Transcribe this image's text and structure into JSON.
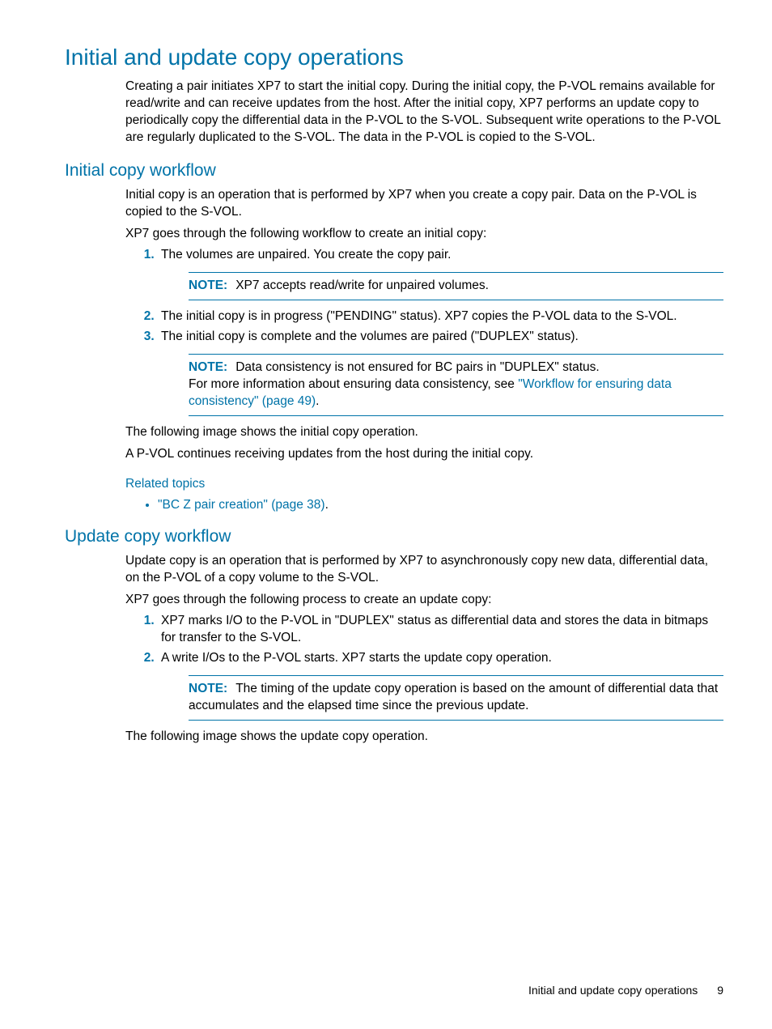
{
  "h1": "Initial and update copy operations",
  "p_intro": "Creating a pair initiates XP7 to start the initial copy. During the initial copy, the P-VOL remains available for read/write and can receive updates from the host. After the initial copy, XP7 performs an update copy to periodically copy the differential data in the P-VOL to the S-VOL. Subsequent write operations to the P-VOL are regularly duplicated to the S-VOL. The data in the P-VOL is copied to the S-VOL.",
  "h2_initial": "Initial copy workflow",
  "p_initial1": "Initial copy is an operation that is performed by XP7 when you create a copy pair. Data on the P-VOL is copied to the S-VOL.",
  "p_initial2": "XP7 goes through the following workflow to create an initial copy:",
  "ol1_li1": "The volumes are unpaired. You create the copy pair.",
  "note_label": "NOTE:",
  "note1": "XP7 accepts read/write for unpaired volumes.",
  "ol1_li2": "The initial copy is in progress (\"PENDING\" status). XP7 copies the P-VOL data to the S-VOL.",
  "ol1_li3": "The initial copy is complete and the volumes are paired (\"DUPLEX\" status).",
  "note2a": "Data consistency is not ensured for BC pairs in \"DUPLEX\" status.",
  "note2b": "For more information about ensuring data consistency, see ",
  "note2link": "\"Workflow for ensuring data consistency\" (page 49)",
  "note2c": ".",
  "p_initial3": "The following image shows the initial copy operation.",
  "p_initial4": "A P-VOL continues receiving updates from the host during the initial copy.",
  "related_topics": "Related topics",
  "rel_link1": "\"BC Z pair creation\" (page 38)",
  "rel_link1_after": ".",
  "h2_update": "Update copy workflow",
  "p_update1": "Update copy is an operation that is performed by XP7 to asynchronously copy new data, differential data, on the P-VOL of a copy volume to the S-VOL.",
  "p_update2": "XP7 goes through the following process to create an update copy:",
  "ol2_li1": "XP7 marks I/O to the P-VOL in \"DUPLEX\" status as differential data and stores the data in bitmaps for transfer to the S-VOL.",
  "ol2_li2": "A write I/Os to the P-VOL starts. XP7 starts the update copy operation.",
  "note3": "The timing of the update copy operation is based on the amount of differential data that accumulates and the elapsed time since the previous update.",
  "p_update3": "The following image shows the update copy operation.",
  "footer_text": "Initial and update copy operations",
  "footer_page": "9"
}
